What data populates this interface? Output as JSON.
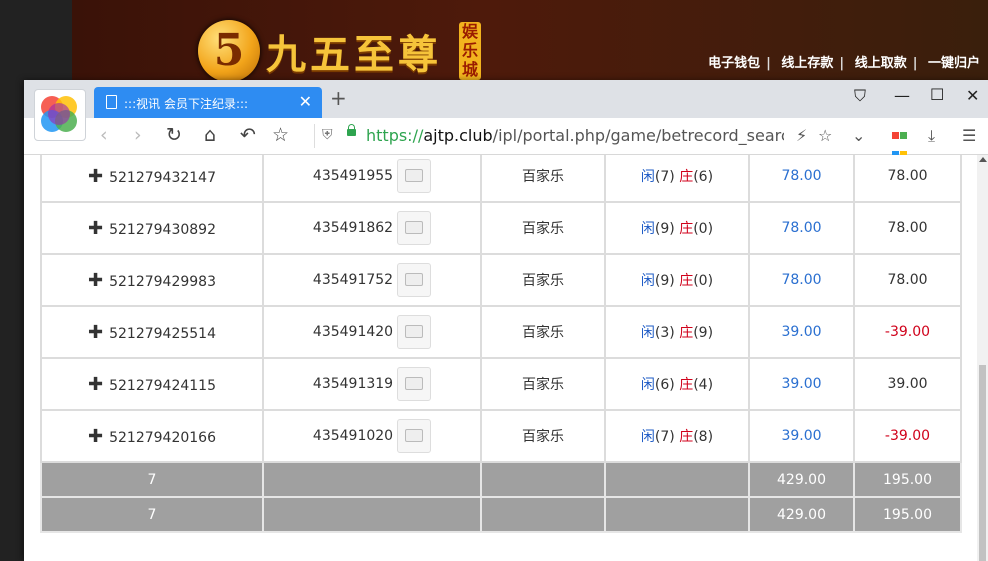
{
  "site": {
    "logo_number": "5",
    "logo_text": "九五至尊",
    "logo_badge": "娱乐城",
    "links": [
      "电子钱包",
      "线上存款",
      "线上取款",
      "一键归户"
    ]
  },
  "browser": {
    "tab_title": ":::视讯 会员下注纪录:::",
    "url_scheme": "https://",
    "url_host": "ajtp.club",
    "url_path": "/ipl/portal.php/game/betrecord_search/k"
  },
  "table": {
    "rows": [
      {
        "id": "521279432147",
        "round": "435491955",
        "game": "百家乐",
        "player_label": "闲",
        "player_score": "(7)",
        "banker_label": "庄",
        "banker_score": "(6)",
        "bet": "78.00",
        "result": "78.00",
        "result_color": "#333333"
      },
      {
        "id": "521279430892",
        "round": "435491862",
        "game": "百家乐",
        "player_label": "闲",
        "player_score": "(9)",
        "banker_label": "庄",
        "banker_score": "(0)",
        "bet": "78.00",
        "result": "78.00",
        "result_color": "#333333"
      },
      {
        "id": "521279429983",
        "round": "435491752",
        "game": "百家乐",
        "player_label": "闲",
        "player_score": "(9)",
        "banker_label": "庄",
        "banker_score": "(0)",
        "bet": "78.00",
        "result": "78.00",
        "result_color": "#333333"
      },
      {
        "id": "521279425514",
        "round": "435491420",
        "game": "百家乐",
        "player_label": "闲",
        "player_score": "(3)",
        "banker_label": "庄",
        "banker_score": "(9)",
        "bet": "39.00",
        "result": "-39.00",
        "result_color": "#d0021b"
      },
      {
        "id": "521279424115",
        "round": "435491319",
        "game": "百家乐",
        "player_label": "闲",
        "player_score": "(6)",
        "banker_label": "庄",
        "banker_score": "(4)",
        "bet": "39.00",
        "result": "39.00",
        "result_color": "#333333"
      },
      {
        "id": "521279420166",
        "round": "435491020",
        "game": "百家乐",
        "player_label": "闲",
        "player_score": "(7)",
        "banker_label": "庄",
        "banker_score": "(8)",
        "bet": "39.00",
        "result": "-39.00",
        "result_color": "#d0021b"
      }
    ],
    "totals": [
      {
        "count": "7",
        "bet": "429.00",
        "result": "195.00"
      },
      {
        "count": "7",
        "bet": "429.00",
        "result": "195.00"
      }
    ]
  }
}
